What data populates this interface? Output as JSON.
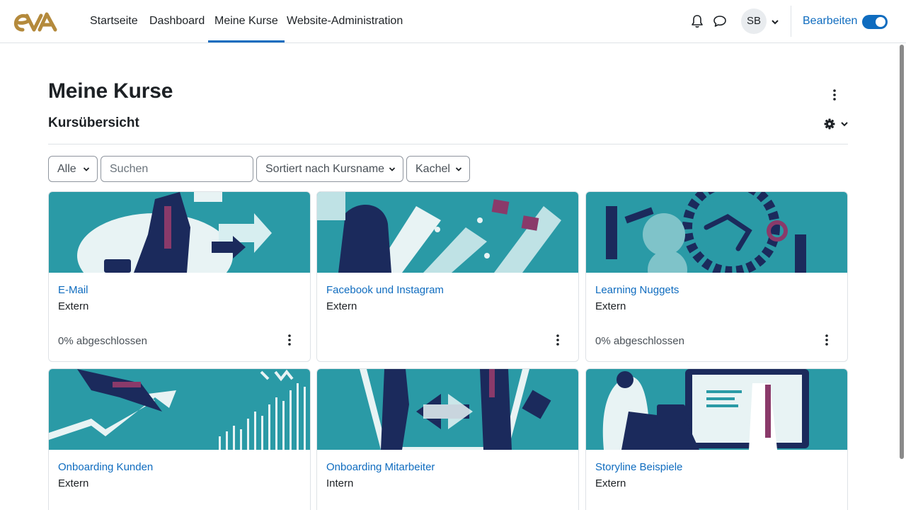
{
  "brand": {
    "logo_text": "eVA",
    "logo_color": "#b48a3c"
  },
  "nav": {
    "items": [
      {
        "label": "Startseite"
      },
      {
        "label": "Dashboard"
      },
      {
        "label": "Meine Kurse",
        "active": true
      },
      {
        "label": "Website-Administration"
      }
    ],
    "icons": [
      "bell-icon",
      "chat-icon"
    ],
    "user_initials": "SB",
    "edit_mode_label": "Bearbeiten",
    "edit_mode_on": true,
    "accent": "#0f6cbf"
  },
  "page": {
    "title": "Meine Kurse",
    "section_title": "Kursübersicht"
  },
  "filters": {
    "grouping": "Alle",
    "search_placeholder": "Suchen",
    "sort": "Sortiert nach Kursname",
    "view": "Kachel"
  },
  "courses": [
    {
      "name": "E-Mail",
      "category": "Extern",
      "progress_text": "0% abgeschlossen",
      "progress": 0
    },
    {
      "name": "Facebook und Instagram",
      "category": "Extern",
      "progress_text": "",
      "progress": null
    },
    {
      "name": "Learning Nuggets",
      "category": "Extern",
      "progress_text": "0% abgeschlossen",
      "progress": 0
    },
    {
      "name": "Onboarding Kunden",
      "category": "Extern",
      "progress_text": "",
      "progress": null
    },
    {
      "name": "Onboarding Mitarbeiter",
      "category": "Intern",
      "progress_text": "",
      "progress": null
    },
    {
      "name": "Storyline Beispiele",
      "category": "Extern",
      "progress_text": "",
      "progress": null
    }
  ],
  "colors": {
    "card_image_teal": "#2a9aa6",
    "illustration_navy": "#1b2a5c",
    "illustration_accent": "#8a3a6a"
  }
}
